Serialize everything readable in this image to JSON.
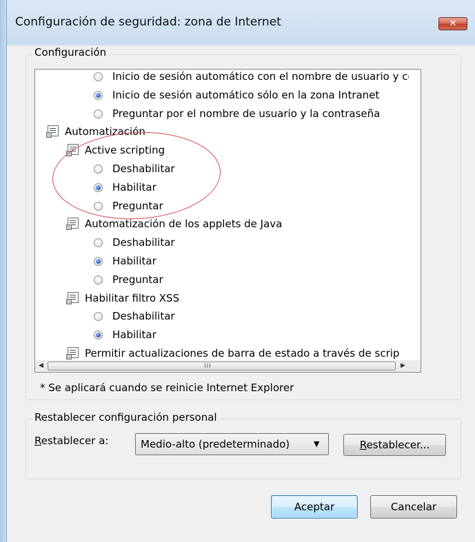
{
  "window": {
    "title": "Configuración de seguridad: zona de Internet",
    "close_label": "✕"
  },
  "settings_group": {
    "label": "Configuración",
    "items": [
      {
        "type": "radio",
        "text": "Inicio de sesión automático con el nombre de usuario y co",
        "checked": false
      },
      {
        "type": "radio",
        "text": "Inicio de sesión automático sólo en la zona Intranet",
        "checked": true
      },
      {
        "type": "radio",
        "text": "Preguntar por el nombre de usuario y la contraseña",
        "checked": false
      },
      {
        "type": "category",
        "text": "Automatización"
      },
      {
        "type": "category",
        "text": "Active scripting"
      },
      {
        "type": "radio",
        "text": "Deshabilitar",
        "checked": false
      },
      {
        "type": "radio",
        "text": "Habilitar",
        "checked": true
      },
      {
        "type": "radio",
        "text": "Preguntar",
        "checked": false
      },
      {
        "type": "category",
        "text": "Automatización de los applets de Java"
      },
      {
        "type": "radio",
        "text": "Deshabilitar",
        "checked": false
      },
      {
        "type": "radio",
        "text": "Habilitar",
        "checked": true
      },
      {
        "type": "radio",
        "text": "Preguntar",
        "checked": false
      },
      {
        "type": "category",
        "text": "Habilitar filtro XSS"
      },
      {
        "type": "radio",
        "text": "Deshabilitar",
        "checked": false
      },
      {
        "type": "radio",
        "text": "Habilitar",
        "checked": true
      },
      {
        "type": "category",
        "text": "Permitir actualizaciones de barra de estado a través de scrip"
      }
    ],
    "scroll_up_icon": "▲",
    "scroll_down_icon": "▼",
    "scroll_left_icon": "◀",
    "scroll_right_icon": "▶",
    "h_thumb_grip": "III",
    "restart_note": "* Se aplicará cuando se reinicie Internet Explorer"
  },
  "reset_group": {
    "label": "Restablecer configuración personal",
    "reset_to_label_pre": "",
    "reset_to_label_u": "R",
    "reset_to_label_post": "establecer a:",
    "selected_level": "Medio-alto (predeterminado)",
    "dropdown_arrow": "▼",
    "reset_button_pre": "",
    "reset_button_u": "R",
    "reset_button_post": "establecer..."
  },
  "buttons": {
    "ok": "Aceptar",
    "cancel": "Cancelar"
  },
  "colors": {
    "annotation_ellipse": "#d8454d",
    "radio_selected": "#2a64c8",
    "close_button": "#c0402c"
  }
}
